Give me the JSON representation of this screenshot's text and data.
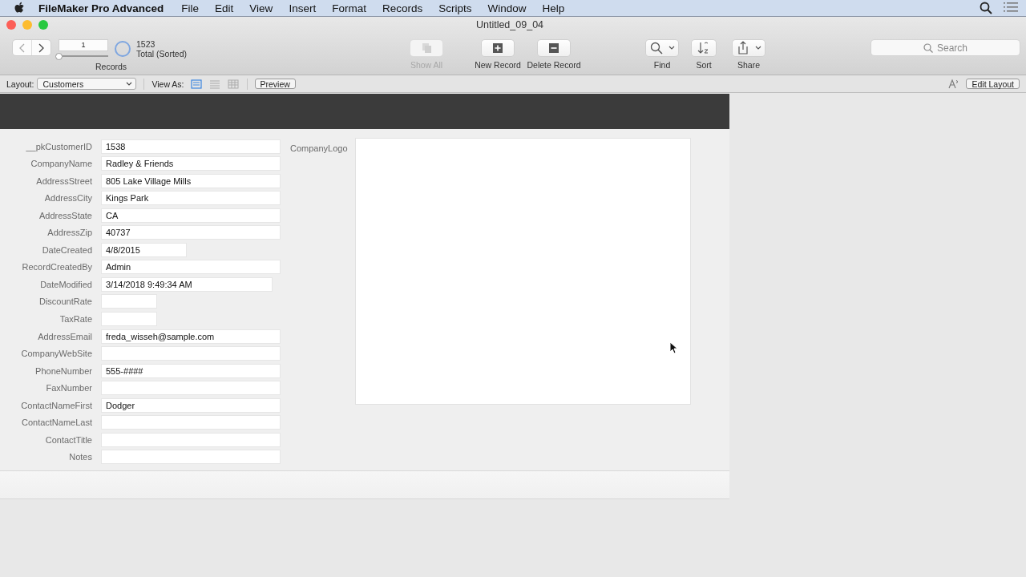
{
  "menu_bar": {
    "app_name": "FileMaker Pro Advanced",
    "items": [
      "File",
      "Edit",
      "View",
      "Insert",
      "Format",
      "Records",
      "Scripts",
      "Window",
      "Help"
    ]
  },
  "window": {
    "title": "Untitled_09_04"
  },
  "toolbar": {
    "record_number": "1",
    "record_slider": {
      "level": 0
    },
    "record_count": "1523",
    "record_status": "Total (Sorted)",
    "records_label": "Records",
    "buttons": [
      {
        "label": "Show All",
        "kind": "show-all",
        "disabled": true
      },
      {
        "label": "New Record",
        "kind": "new",
        "disabled": false
      },
      {
        "label": "Delete Record",
        "kind": "delete",
        "disabled": false
      },
      {
        "label": "Find",
        "kind": "find",
        "disabled": false
      },
      {
        "label": "Sort",
        "kind": "sort",
        "disabled": false
      },
      {
        "label": "Share",
        "kind": "share",
        "disabled": false
      }
    ],
    "search": {
      "placeholder": "Search"
    }
  },
  "layout_bar": {
    "layout_label": "Layout:",
    "layout": "Customers",
    "view_as_label": "View As:",
    "view_modes": [
      {
        "kind": "form",
        "selected": true
      },
      {
        "kind": "list",
        "selected": false
      },
      {
        "kind": "table",
        "selected": false
      }
    ],
    "preview": "Preview",
    "edit_layout": "Edit Layout"
  },
  "form": {
    "fields": [
      {
        "label": "__pkCustomerID",
        "value": "1538",
        "kind": "text"
      },
      {
        "label": "CompanyName",
        "value": "Radley & Friends",
        "kind": "text"
      },
      {
        "label": "AddressStreet",
        "value": "805 Lake Village Mills",
        "kind": "text"
      },
      {
        "label": "AddressCity",
        "value": "Kings Park",
        "kind": "text"
      },
      {
        "label": "AddressState",
        "value": "CA",
        "kind": "text"
      },
      {
        "label": "AddressZip",
        "value": "40737",
        "kind": "text"
      },
      {
        "label": "DateCreated",
        "value": "4/8/2015",
        "kind": "date"
      },
      {
        "label": "RecordCreatedBy",
        "value": "Admin",
        "kind": "text"
      },
      {
        "label": "DateModified",
        "value": "3/14/2018 9:49:34 AM",
        "kind": "timestamp"
      },
      {
        "label": "DiscountRate",
        "kind": "number"
      },
      {
        "label": "TaxRate",
        "kind": "number"
      },
      {
        "label": "AddressEmail",
        "value": "freda_wisseh@sample.com",
        "kind": "text"
      },
      {
        "label": "CompanyWebSite",
        "kind": "text"
      },
      {
        "label": "PhoneNumber",
        "value": "555-####",
        "kind": "text"
      },
      {
        "label": "FaxNumber",
        "kind": "text"
      },
      {
        "label": "ContactNameFirst",
        "value": "Dodger",
        "kind": "text"
      },
      {
        "label": "ContactNameLast",
        "kind": "text"
      },
      {
        "label": "ContactTitle",
        "kind": "text"
      },
      {
        "label": "Notes",
        "kind": "text"
      }
    ],
    "container": {
      "label": "CompanyLogo"
    }
  }
}
